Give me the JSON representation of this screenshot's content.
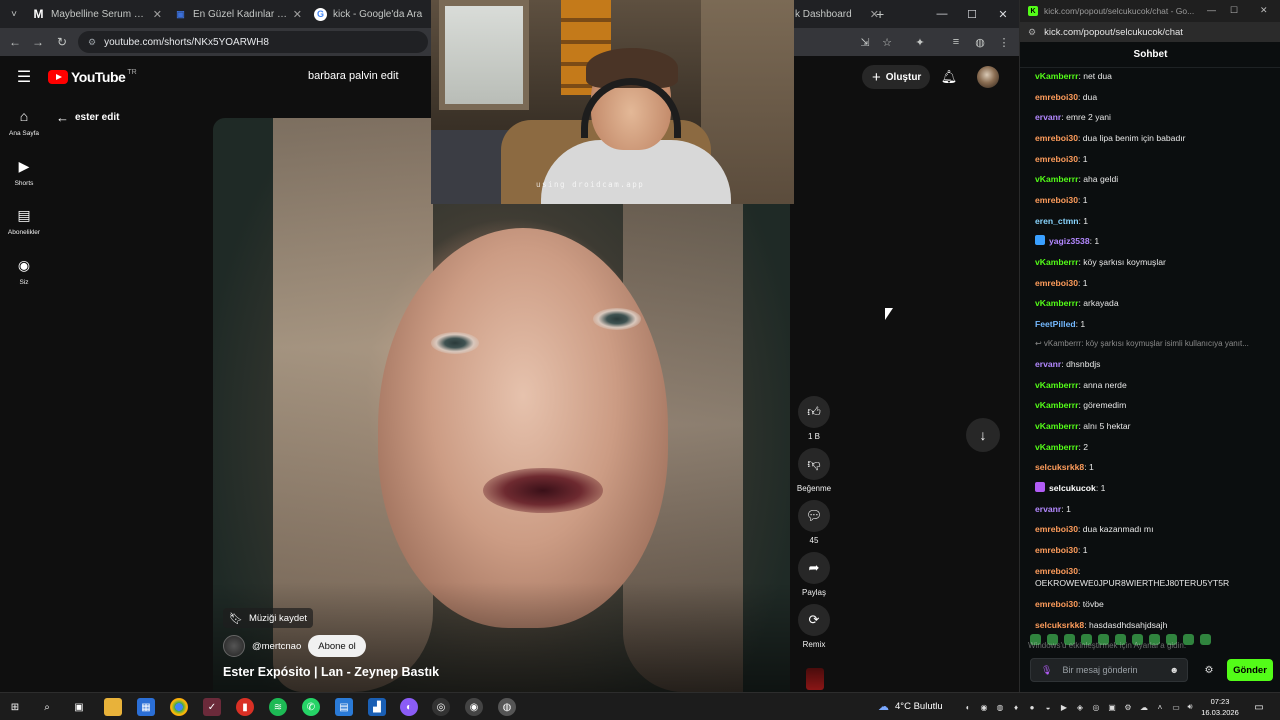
{
  "browser": {
    "tabs": [
      {
        "label": "Maybelline Serum Lipstick",
        "icon": "M",
        "color": "#111111"
      },
      {
        "label": "En Güzel Kadınlar (Güncel)",
        "icon": "▣",
        "color": "#3b6fd8"
      },
      {
        "label": "kick - Google'da Ara",
        "icon": "G",
        "color": "#ffffff"
      }
    ],
    "tab_partial": "k Dashboard",
    "url": "youtube.com/shorts/NKx5YOARWH8"
  },
  "youtube": {
    "logo_text": "YouTube",
    "country": "TR",
    "search_value": "barbara palvin edit",
    "create_label": "Oluştur",
    "nav": [
      {
        "label": "Ana Sayfa",
        "icon": "⌂"
      },
      {
        "label": "Shorts",
        "icon": "▶"
      },
      {
        "label": "Abonelikler",
        "icon": "▤"
      },
      {
        "label": "Siz",
        "icon": "◉"
      }
    ],
    "back_label": "ester edit",
    "webcam_watermark": "using droidcam.app",
    "save_music": "Müziği kaydet",
    "channel": "@mertcnao",
    "subscribe": "Abone ol",
    "title": "Ester Expósito | Lan - Zeynep Bastık",
    "actions": {
      "like": "1 B",
      "dislike": "Beğenme",
      "comments": "45",
      "share": "Paylaş",
      "remix": "Remix"
    }
  },
  "kick": {
    "window_title": "kick.com/popout/selcukucok/chat - Go...",
    "url": "kick.com/popout/selcukucok/chat",
    "header": "Sohbet",
    "messages": [
      {
        "user": "vKamberrr",
        "text": "net dua",
        "color": "#53fc18"
      },
      {
        "user": "emreboi30",
        "text": "dua",
        "color": "#ff9d5c"
      },
      {
        "user": "ervanr",
        "text": "emre 2 yani",
        "color": "#b388ff"
      },
      {
        "user": "emreboi30",
        "text": "dua lipa benim için babadır",
        "color": "#ff9d5c"
      },
      {
        "user": "emreboi30",
        "text": "1",
        "color": "#ff9d5c"
      },
      {
        "user": "vKamberrr",
        "text": "aha geldi",
        "color": "#53fc18"
      },
      {
        "user": "emreboi30",
        "text": "1",
        "color": "#ff9d5c"
      },
      {
        "user": "eren_ctmn",
        "text": "1",
        "color": "#8ad6ff"
      },
      {
        "user": "yagiz3538",
        "text": "1",
        "color": "#b388ff",
        "badge": "#3aa0ff"
      },
      {
        "user": "vKamberrr",
        "text": "köy şarkısı koymuşlar",
        "color": "#53fc18"
      },
      {
        "user": "emreboi30",
        "text": "1",
        "color": "#ff9d5c"
      },
      {
        "user": "vKamberrr",
        "text": "arkayada",
        "color": "#53fc18"
      },
      {
        "user": "FeetPilled",
        "text": "1",
        "color": "#74b9ff"
      },
      {
        "user": "",
        "text": "↩ vKamberrr: köy şarkısı koymuşlar isimli kullanıcıya yanıt...",
        "color": "#8a8a8a",
        "reply": true
      },
      {
        "user": "ervanr",
        "text": "dhsnbdjs",
        "color": "#b388ff"
      },
      {
        "user": "vKamberrr",
        "text": "anna nerde",
        "color": "#53fc18"
      },
      {
        "user": "vKamberrr",
        "text": "göremedim",
        "color": "#53fc18"
      },
      {
        "user": "vKamberrr",
        "text": "alnı 5 hektar",
        "color": "#53fc18"
      },
      {
        "user": "vKamberrr",
        "text": "2",
        "color": "#53fc18"
      },
      {
        "user": "selcuksrkk8",
        "text": "1",
        "color": "#ff9d5c"
      },
      {
        "user": "selcukucok",
        "text": "1",
        "color": "#ffffff",
        "badge": "#b15cf5"
      },
      {
        "user": "ervanr",
        "text": "1",
        "color": "#b388ff"
      },
      {
        "user": "emreboi30",
        "text": "dua kazanmadı mı",
        "color": "#ff9d5c"
      },
      {
        "user": "emreboi30",
        "text": "1",
        "color": "#ff9d5c"
      },
      {
        "user": "emreboi30",
        "text": "OEKROWEWE0JPUR8WIERTHEJ80TERU5YT5R",
        "color": "#ff9d5c",
        "wrap": true
      },
      {
        "user": "emreboi30",
        "text": "tövbe",
        "color": "#ff9d5c"
      },
      {
        "user": "selcuksrkk8",
        "text": "hasdasdhdsahjdsajh",
        "color": "#ff9d5c"
      }
    ],
    "activate_windows": "Windows'u etkinleştirmek için Ayarlar'a gidin.",
    "input_placeholder": "Bir mesaj gönderin",
    "send_label": "Gönder"
  },
  "taskbar": {
    "weather": "4°C Bulutlu",
    "time": "07:23",
    "date": "16.03.2026"
  }
}
